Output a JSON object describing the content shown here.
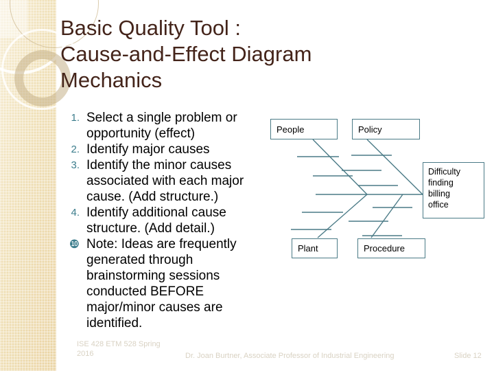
{
  "slide": {
    "title": "Basic Quality Tool :\nCause-and-Effect Diagram\nMechanics",
    "title_color": "#44241a",
    "background_color": "#ffffff",
    "accent_color": "#4a7a86",
    "marker_color": "#3c7d8c",
    "panel_color": "#f2e3bd"
  },
  "body": {
    "items": [
      {
        "marker": "1.",
        "text": "Select a single problem or opportunity (effect)"
      },
      {
        "marker": "2.",
        "text": "Identify major causes"
      },
      {
        "marker": "3.",
        "text": "Identify the minor causes associated with each major cause. (Add structure.)"
      },
      {
        "marker": "4.",
        "text": "Identify additional cause structure.  (Add detail.)"
      },
      {
        "marker": "❿",
        "text": "Note: Ideas are frequently generated through brainstorming sessions conducted BEFORE major/minor causes are identified."
      }
    ]
  },
  "diagram": {
    "type": "fishbone-cause-and-effect",
    "boxes": {
      "people": "People",
      "policy": "Policy",
      "plant": "Plant",
      "procedure": "Procedure",
      "effect": "Difficulty\nfinding\nbilling\noffice"
    }
  },
  "footer": {
    "course": "ISE 428 ETM 528 Spring 2016",
    "presenter": "Dr. Joan Burtner, Associate Professor of Industrial Engineering",
    "slide_number": "Slide 12"
  }
}
